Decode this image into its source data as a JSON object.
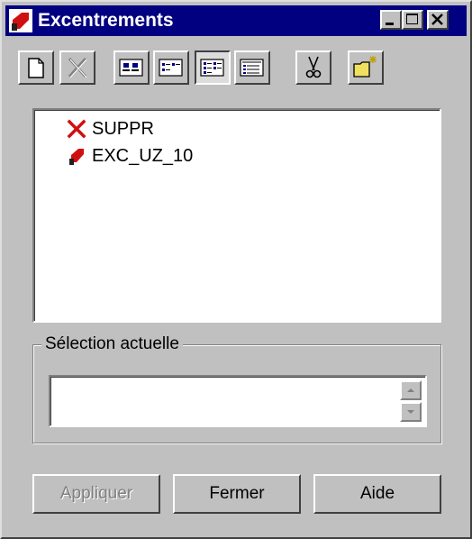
{
  "window": {
    "title": "Excentrements",
    "controls": [
      "minimize-icon",
      "maximize-icon",
      "close-icon"
    ]
  },
  "toolbar": {
    "buttons": [
      {
        "icon": "new-document-icon"
      },
      {
        "icon": "delete-icon"
      },
      {
        "icon": "large-icons-view-icon"
      },
      {
        "icon": "small-icons-view-icon"
      },
      {
        "icon": "list-view-icon",
        "pressed": true
      },
      {
        "icon": "details-view-icon"
      },
      {
        "icon": "scissors-icon"
      },
      {
        "icon": "new-folder-icon"
      }
    ]
  },
  "list": {
    "items": [
      {
        "label": "SUPPR",
        "icon": "red-x-icon"
      },
      {
        "label": "EXC_UZ_10",
        "icon": "excentrement-icon"
      }
    ]
  },
  "selection": {
    "group_label": "Sélection actuelle",
    "value": ""
  },
  "buttons": {
    "apply": "Appliquer",
    "close": "Fermer",
    "help": "Aide"
  },
  "colors": {
    "title_bar": "#000080",
    "face": "#c0c0c0",
    "accent_red": "#d01010"
  }
}
